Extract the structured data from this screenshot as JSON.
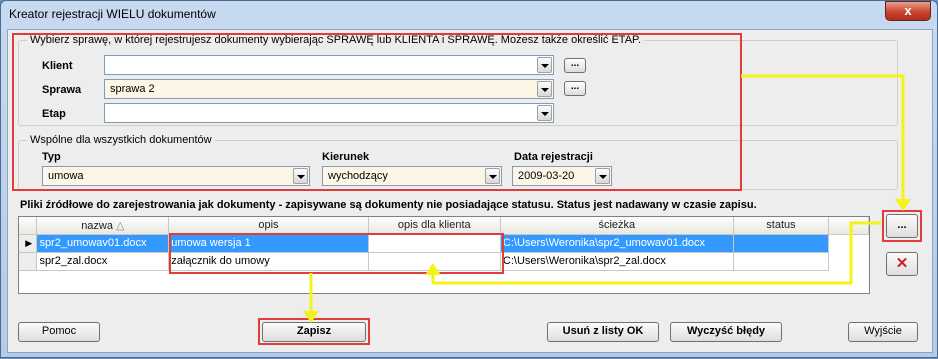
{
  "window": {
    "title": "Kreator rejestracji WIELU dokumentów",
    "close_glyph": "x"
  },
  "group_case": {
    "title": "Wybierz sprawę, w której rejestrujesz dokumenty wybierając SPRAWĘ lub  KLIENTA i SPRAWĘ. Możesz także określić ETAP.",
    "client_label": "Klient",
    "client_value": "",
    "case_label": "Sprawa",
    "case_value": "sprawa 2",
    "stage_label": "Etap",
    "stage_value": "",
    "browse_label": "..."
  },
  "group_common": {
    "title": "Wspólne dla wszystkich dokumentów",
    "type_label": "Typ",
    "type_value": "umowa",
    "direction_label": "Kierunek",
    "direction_value": "wychodzący",
    "date_label": "Data rejestracji",
    "date_value": "2009-03-20"
  },
  "files": {
    "title": "Pliki źródłowe do zarejestrowania jak dokumenty - zapisywane są dokumenty nie posiadające statusu. Status jest nadawany w czasie zapisu.",
    "columns": [
      "nazwa",
      "opis",
      "opis dla klienta",
      "ścieżka",
      "status"
    ],
    "sort_glyph": "△",
    "rows": [
      {
        "nazwa": "spr2_umowav01.docx",
        "opis": "umowa wersja 1",
        "opis_klienta": "",
        "sciezka": "C:\\Users\\Weronika\\spr2_umowav01.docx",
        "status": ""
      },
      {
        "nazwa": "spr2_zal.docx",
        "opis": "załącznik do umowy",
        "opis_klienta": "",
        "sciezka": "C:\\Users\\Weronika\\spr2_zal.docx",
        "status": ""
      }
    ],
    "row_pointer": "▶",
    "browse_label": "...",
    "delete_glyph": "✕"
  },
  "footer": {
    "help": "Pomoc",
    "save": "Zapisz",
    "remove_ok": "Usuń z listy  OK",
    "clear_errors": "Wyczyść błędy",
    "exit": "Wyjście"
  }
}
